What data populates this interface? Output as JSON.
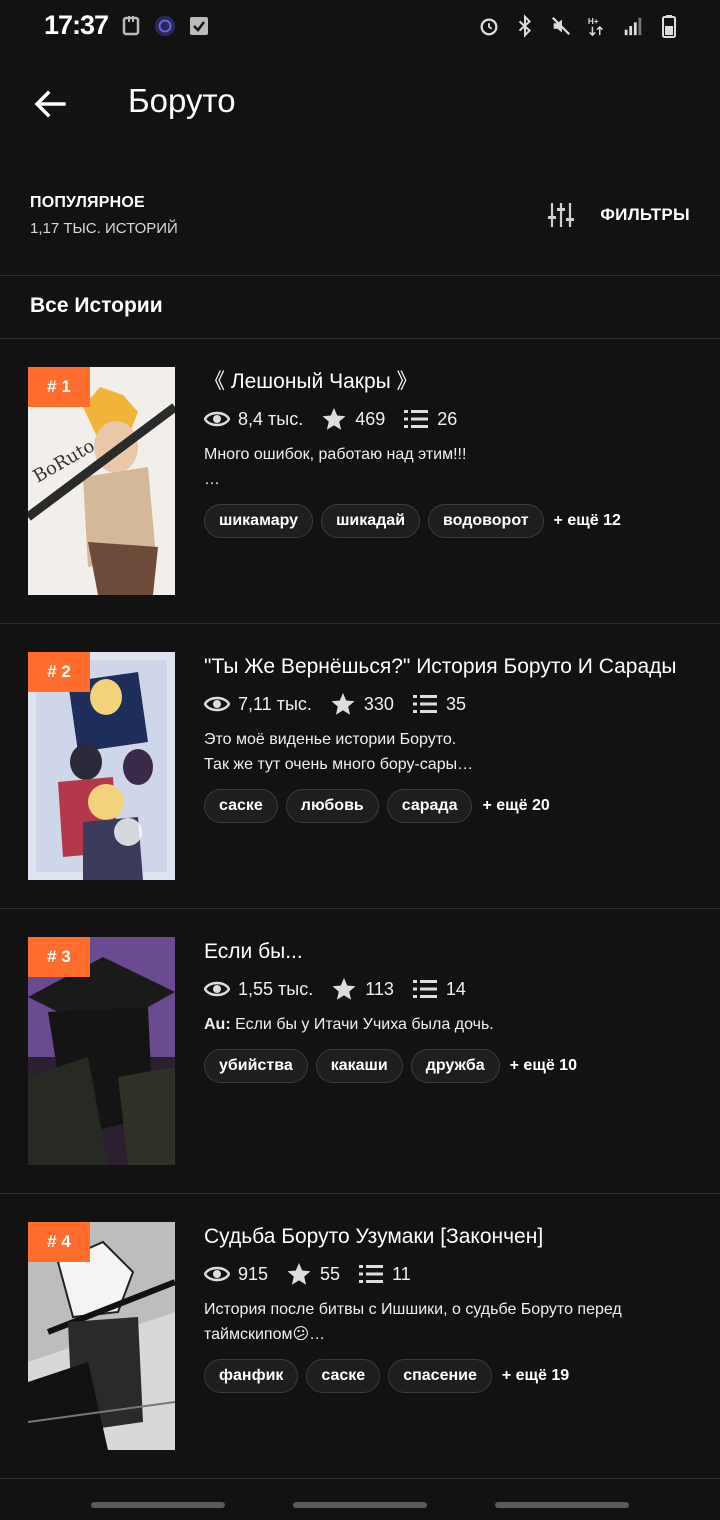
{
  "status_bar": {
    "time": "17:37",
    "icons_left": [
      "usb-icon",
      "app-badge-icon",
      "check-icon"
    ],
    "icons_right": [
      "alarm-icon",
      "bluetooth-icon",
      "mute-icon",
      "network-hplus-icon",
      "signal-icon",
      "battery-icon"
    ]
  },
  "header": {
    "title": "Боруто",
    "back_icon": "arrow-left-icon"
  },
  "sort_bar": {
    "label": "ПОПУЛЯРНОЕ",
    "count": "1,17 ТЫС. ИСТОРИЙ",
    "filter_label": "ФИЛЬТРЫ",
    "filter_icon": "sliders-icon"
  },
  "section": {
    "title": "Все Истории"
  },
  "colors": {
    "background": "#121212",
    "accent": "#ff6d2e",
    "divider": "#2e2e2e",
    "tag_border": "#3c3c3c"
  },
  "stories": [
    {
      "rank": "# 1",
      "title": "《 Лешоный Чакры 》",
      "views": "8,4 тыс.",
      "votes": "469",
      "parts": "26",
      "desc_prefix": "",
      "description": "Много ошибок, работаю над этим!!!\n…",
      "tags": [
        "шикамару",
        "шикадай",
        "водоворот"
      ],
      "more": "+ ещё 12"
    },
    {
      "rank": "# 2",
      "title": "\"Ты Же Вернёшься?\" История Боруто И Сарады",
      "views": "7,11 тыс.",
      "votes": "330",
      "parts": "35",
      "desc_prefix": "",
      "description": "Это моё виденье истории Боруто.\nТак же тут очень много бору-сары…",
      "tags": [
        "саске",
        "любовь",
        "сарада"
      ],
      "more": "+ ещё 20"
    },
    {
      "rank": "# 3",
      "title": "Если бы...",
      "views": "1,55 тыс.",
      "votes": "113",
      "parts": "14",
      "desc_prefix": "Au:",
      "description": " Если бы у Итачи Учиха была дочь.",
      "tags": [
        "убийства",
        "какаши",
        "дружба"
      ],
      "more": "+ ещё 10"
    },
    {
      "rank": "# 4",
      "title": "Судьба Боруто Узумаки [Закончен]",
      "views": "915",
      "votes": "55",
      "parts": "11",
      "desc_prefix": "",
      "description": "История после битвы с Ишшики, о судьбе Боруто перед таймскипом😕…",
      "tags": [
        "фанфик",
        "саске",
        "спасение"
      ],
      "more": "+ ещё 19"
    }
  ]
}
